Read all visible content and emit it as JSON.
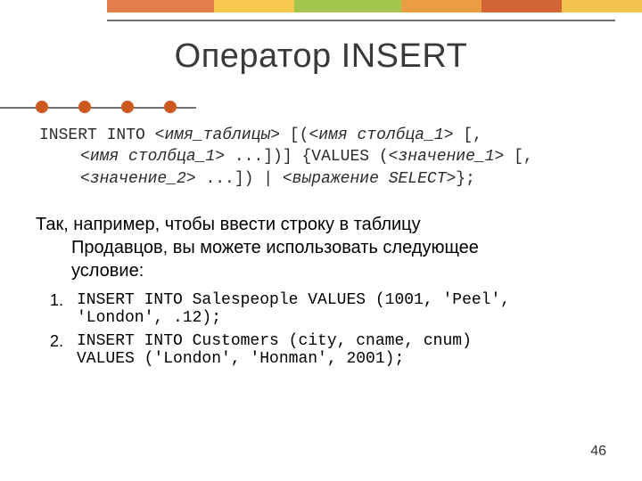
{
  "title": "Оператор INSERT",
  "syntax": {
    "line1_a": "INSERT INTO <",
    "line1_b": "имя_таблицы",
    "line1_c": "> [(<",
    "line1_d": "имя столбца_1",
    "line1_e": "> [,",
    "line2_a": "<",
    "line2_b": "имя столбца_1",
    "line2_c": "> ...])] {VALUES (<",
    "line2_d": "значение_1",
    "line2_e": "> [,",
    "line3_a": "<",
    "line3_b": "значение_2",
    "line3_c": "> ...]) | <",
    "line3_d": "выражение SELECT",
    "line3_e": ">};"
  },
  "para": {
    "line1": "Так, например, чтобы ввести строку в таблицу",
    "line2": "Продавцов, вы можете использовать следующее",
    "line3": "условие:"
  },
  "examples": [
    {
      "l1": "INSERT INTO Salespeople VALUES (1001, 'Peel',",
      "l2": "'London', .12);"
    },
    {
      "l1": "INSERT INTO Customers (city, cname, cnum)",
      "l2": "VALUES ('London', 'Honman', 2001);"
    }
  ],
  "page_number": "46"
}
